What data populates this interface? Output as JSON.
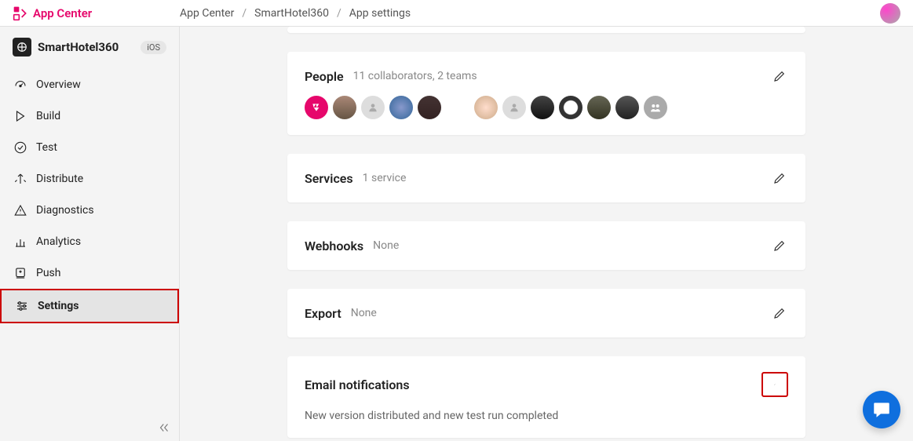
{
  "header": {
    "brand": "App Center",
    "breadcrumb": [
      "App Center",
      "SmartHotel360",
      "App settings"
    ]
  },
  "sidebar": {
    "app": {
      "name": "SmartHotel360",
      "os": "iOS"
    },
    "items": [
      {
        "icon": "gauge",
        "label": "Overview"
      },
      {
        "icon": "play",
        "label": "Build"
      },
      {
        "icon": "check-circle",
        "label": "Test"
      },
      {
        "icon": "distribute",
        "label": "Distribute"
      },
      {
        "icon": "warning",
        "label": "Diagnostics"
      },
      {
        "icon": "bars",
        "label": "Analytics"
      },
      {
        "icon": "push",
        "label": "Push"
      },
      {
        "icon": "sliders",
        "label": "Settings"
      }
    ],
    "active_index": 7
  },
  "cards": {
    "people": {
      "title": "People",
      "subtitle": "11 collaborators, 2 teams"
    },
    "services": {
      "title": "Services",
      "subtitle": "1 service"
    },
    "webhooks": {
      "title": "Webhooks",
      "subtitle": "None"
    },
    "export": {
      "title": "Export",
      "subtitle": "None"
    },
    "email": {
      "title": "Email notifications",
      "body": "New version distributed and new test run completed"
    }
  }
}
